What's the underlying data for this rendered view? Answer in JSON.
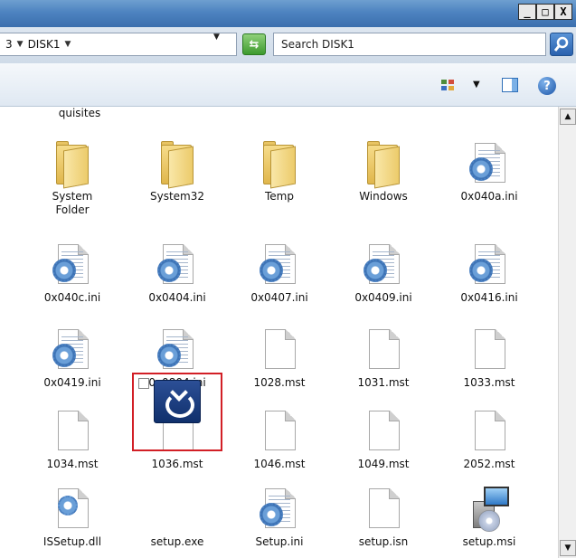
{
  "window": {
    "controls": [
      "_",
      "□",
      "X"
    ]
  },
  "address": {
    "breadcrumb": [
      "3",
      "DISK1"
    ],
    "search_placeholder": "Search DISK1"
  },
  "content": {
    "partial_label": "quisites",
    "items": [
      {
        "label": "System\nFolder",
        "icon": "folder-icon"
      },
      {
        "label": "System32",
        "icon": "folder-icon"
      },
      {
        "label": "Temp",
        "icon": "folder-icon"
      },
      {
        "label": "Windows",
        "icon": "folder-icon"
      },
      {
        "label": "0x040a.ini",
        "icon": "settings-file-icon"
      },
      {
        "label": "0x040c.ini",
        "icon": "settings-file-icon"
      },
      {
        "label": "0x0404.ini",
        "icon": "settings-file-icon"
      },
      {
        "label": "0x0407.ini",
        "icon": "settings-file-icon"
      },
      {
        "label": "0x0409.ini",
        "icon": "settings-file-icon"
      },
      {
        "label": "0x0416.ini",
        "icon": "settings-file-icon"
      },
      {
        "label": "0x0419.ini",
        "icon": "settings-file-icon"
      },
      {
        "label": "0x0804.ini",
        "icon": "settings-file-icon"
      },
      {
        "label": "1028.mst",
        "icon": "document-icon"
      },
      {
        "label": "1031.mst",
        "icon": "document-icon"
      },
      {
        "label": "1033.mst",
        "icon": "document-icon"
      },
      {
        "label": "1034.mst",
        "icon": "document-icon"
      },
      {
        "label": "1036.mst",
        "icon": "document-icon"
      },
      {
        "label": "1046.mst",
        "icon": "document-icon"
      },
      {
        "label": "1049.mst",
        "icon": "document-icon"
      },
      {
        "label": "2052.mst",
        "icon": "document-icon"
      },
      {
        "label": "ISSetup.dll",
        "icon": "dll-icon"
      },
      {
        "label": "setup.exe",
        "icon": "setup-exe-icon"
      },
      {
        "label": "Setup.ini",
        "icon": "settings-file-icon"
      },
      {
        "label": "setup.isn",
        "icon": "document-icon"
      },
      {
        "label": "setup.msi",
        "icon": "installer-package-icon"
      }
    ]
  },
  "selected_item": "setup.exe",
  "colors": {
    "selection_border": "#d21f26",
    "titlebar": "#4d83c0"
  }
}
